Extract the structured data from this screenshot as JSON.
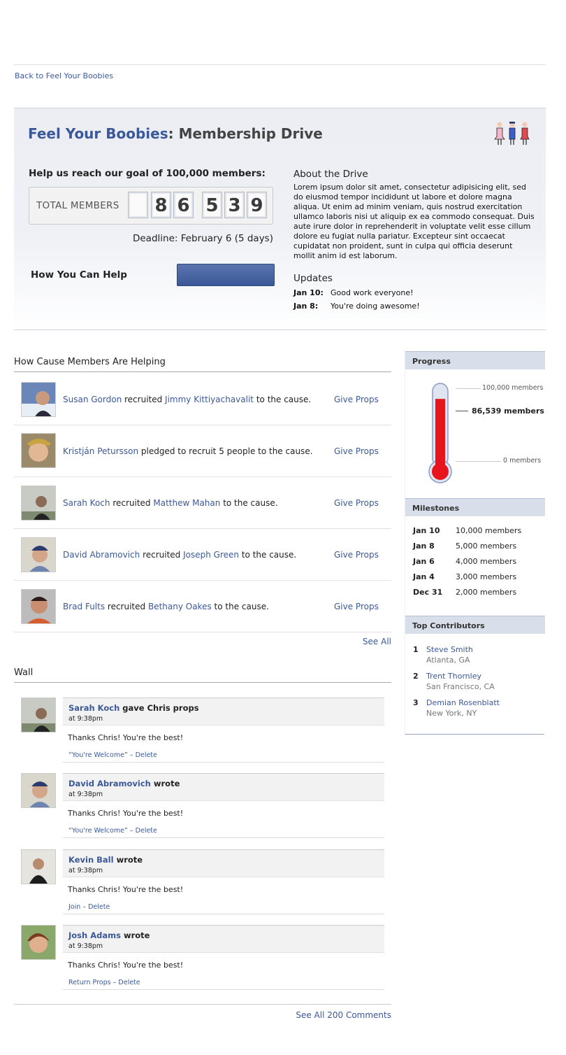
{
  "nav": {
    "back_link": "Back to Feel Your Boobies"
  },
  "header": {
    "cause_name": "Feel Your Boobies",
    "title_suffix": ": Membership Drive"
  },
  "drive": {
    "goal_text": "Help us reach our goal of 100,000 members:",
    "counter_label": "TOTAL MEMBERS",
    "digits": [
      "",
      "8",
      "6",
      "5",
      "3",
      "9"
    ],
    "deadline": "Deadline: February 6 (5 days)",
    "help_label": "How You Can Help",
    "about_title": "About the Drive",
    "about_text": "Lorem ipsum dolor sit amet, consectetur adipisicing elit, sed do eiusmod tempor incididunt ut labore et dolore magna aliqua. Ut enim ad minim veniam, quis nostrud exercitation ullamco laboris nisi ut aliquip ex ea commodo consequat. Duis aute irure dolor in reprehenderit in voluptate velit esse cillum dolore eu fugiat nulla pariatur. Excepteur sint occaecat cupidatat non proident, sunt in culpa qui officia deserunt mollit anim id est laborum.",
    "updates_title": "Updates",
    "updates": [
      {
        "date": "Jan 10:",
        "text": "Good work everyone!"
      },
      {
        "date": "Jan 8:",
        "text": "You're doing awesome!"
      }
    ]
  },
  "helping": {
    "title": "How Cause Members Are Helping",
    "rows": [
      {
        "actor": "Susan Gordon",
        "verb": " recruited ",
        "target": "Jimmy Kittiyachavalit",
        "rest": " to the cause.",
        "action": "Give Props"
      },
      {
        "actor": "Kristján Petursson",
        "verb": " pledged to recruit 5 people to the cause.",
        "target": "",
        "rest": "",
        "action": "Give Props"
      },
      {
        "actor": "Sarah Koch",
        "verb": " recruited ",
        "target": "Matthew Mahan",
        "rest": " to the cause.",
        "action": "Give Props"
      },
      {
        "actor": "David Abramovich",
        "verb": " recruited ",
        "target": "Joseph Green",
        "rest": " to the cause.",
        "action": "Give Props"
      },
      {
        "actor": "Brad Fults",
        "verb": " recruited ",
        "target": "Bethany Oakes",
        "rest": " to the cause.",
        "action": "Give Props"
      }
    ],
    "see_all": "See All"
  },
  "wall": {
    "title": "Wall",
    "posts": [
      {
        "author": "Sarah Koch",
        "verb": " gave Chris props",
        "time": "at 9:38pm",
        "body": "Thanks Chris! You're the best!",
        "action1": "“You're Welcome”",
        "sep": " – ",
        "action2": "Delete"
      },
      {
        "author": "David Abramovich",
        "verb": " wrote",
        "time": "at 9:38pm",
        "body": "Thanks Chris! You're the best!",
        "action1": "“You're Welcome”",
        "sep": " – ",
        "action2": "Delete"
      },
      {
        "author": "Kevin Ball",
        "verb": " wrote",
        "time": "at 9:38pm",
        "body": "Thanks Chris! You're the best!",
        "action1": "Join",
        "sep": " – ",
        "action2": "Delete"
      },
      {
        "author": "Josh Adams",
        "verb": " wrote",
        "time": "at  9:38pm",
        "body": "Thanks Chris! You're the best!",
        "action1": "Return Props",
        "sep": " – ",
        "action2": "Delete"
      }
    ],
    "see_all": "See All 200 Comments"
  },
  "sidebar": {
    "progress_title": "Progress",
    "goal_label": "100,000 members",
    "current_label": "86,539 members",
    "zero_label": "0 members",
    "progress_fraction": 0.86539,
    "milestones_title": "Milestones",
    "milestones": [
      {
        "date": "Jan 10",
        "text": "10,000 members"
      },
      {
        "date": "Jan 8",
        "text": "5,000 members"
      },
      {
        "date": "Jan 6",
        "text": "4,000 members"
      },
      {
        "date": "Jan 4",
        "text": "3,000 members"
      },
      {
        "date": "Dec 31",
        "text": "2,000 members"
      }
    ],
    "contributors_title": "Top Contributors",
    "contributors": [
      {
        "rank": "1",
        "name": "Steve Smith",
        "location": "Atlanta, GA"
      },
      {
        "rank": "2",
        "name": "Trent Thornley",
        "location": "San Francisco, CA"
      },
      {
        "rank": "3",
        "name": "Demian Rosenblatt",
        "location": "New York, NY"
      }
    ]
  },
  "colors": {
    "link": "#3b5998",
    "thermo_fill": "#e8141b",
    "sidebar_header": "#d8dfea"
  }
}
